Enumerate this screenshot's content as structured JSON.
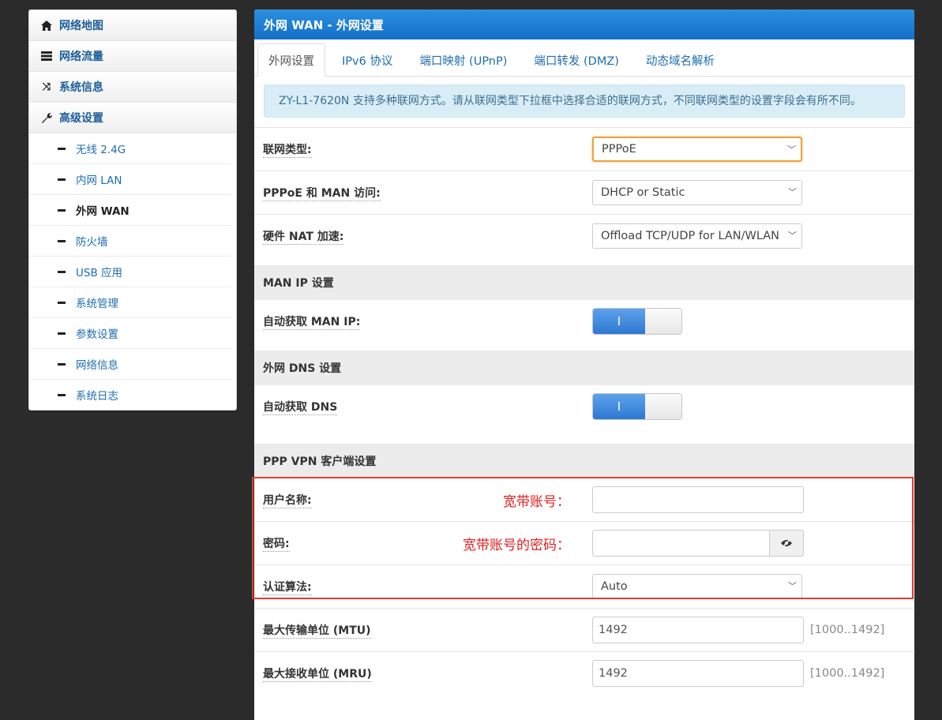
{
  "sidebar": {
    "menus": [
      {
        "label": "网络地图",
        "icon": "home-icon"
      },
      {
        "label": "网络流量",
        "icon": "server-icon"
      },
      {
        "label": "系统信息",
        "icon": "shuffle-icon"
      },
      {
        "label": "高级设置",
        "icon": "wrench-icon"
      }
    ],
    "sub_items": [
      {
        "label": "无线 2.4G"
      },
      {
        "label": "内网 LAN"
      },
      {
        "label": "外网 WAN",
        "active": true
      },
      {
        "label": "防火墙"
      },
      {
        "label": "USB 应用"
      },
      {
        "label": "系统管理"
      },
      {
        "label": "参数设置"
      },
      {
        "label": "网络信息"
      },
      {
        "label": "系统日志"
      }
    ]
  },
  "panel": {
    "title": "外网 WAN - 外网设置",
    "tabs": [
      "外网设置",
      "IPv6 协议",
      "端口映射 (UPnP)",
      "端口转发 (DMZ)",
      "动态域名解析"
    ],
    "info": "ZY-L1-7620N 支持多种联网方式。请从联网类型下拉框中选择合适的联网方式，不同联网类型的设置字段会有所不同。"
  },
  "form": {
    "conn_type": {
      "label": "联网类型:",
      "value": "PPPoE"
    },
    "pppoe_man": {
      "label": "PPPoE 和 MAN 访问:",
      "value": "DHCP or Static"
    },
    "hw_nat": {
      "label": "硬件 NAT 加速:",
      "value": "Offload TCP/UDP for LAN/WLAN"
    },
    "man_ip_section": "MAN IP 设置",
    "auto_man_ip": {
      "label": "自动获取 MAN IP:",
      "state": "I"
    },
    "dns_section": "外网 DNS 设置",
    "auto_dns": {
      "label": "自动获取 DNS",
      "state": "I"
    },
    "vpn_section": "PPP VPN 客户端设置",
    "username": {
      "label": "用户名称:",
      "value": "",
      "annotation": "宽带账号："
    },
    "password": {
      "label": "密码:",
      "value": "",
      "annotation": "宽带账号的密码："
    },
    "auth": {
      "label": "认证算法:",
      "value": "Auto"
    },
    "mtu": {
      "label": "最大传输单位 (MTU)",
      "value": "1492",
      "range": "[1000..1492]"
    },
    "mru": {
      "label": "最大接收单位 (MRU)",
      "value": "1492",
      "range": "[1000..1492]"
    }
  }
}
